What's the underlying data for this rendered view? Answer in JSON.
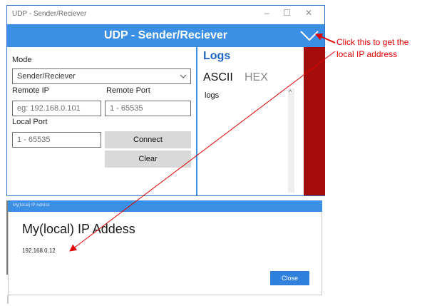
{
  "window": {
    "title_bar_text": "UDP - Sender/Reciever",
    "controls": {
      "minimize": "–",
      "maximize": "☐",
      "close": "✕"
    },
    "header_title": "UDP - Sender/Reciever",
    "colors": {
      "accent": "#3b8fe5",
      "red_panel": "#a50d0d"
    }
  },
  "left": {
    "mode_label": "Mode",
    "mode_value": "Sender/Reciever",
    "remote_ip_label": "Remote IP",
    "remote_ip_placeholder": "eg: 192.168.0.101",
    "remote_port_label": "Remote Port",
    "remote_port_placeholder": "1 - 65535",
    "local_port_label": "Local Port",
    "local_port_placeholder": "1 - 65535",
    "connect_label": "Connect",
    "clear_label": "Clear"
  },
  "right": {
    "logs_title": "Logs",
    "tab_ascii": "ASCII",
    "tab_hex": "HEX",
    "logs_text": "logs",
    "scroll_up_glyph": "^"
  },
  "dialog": {
    "title_bar_text": "My(local) IP Adress",
    "heading": "My(local) IP Addess",
    "ip_value": "192.168.0.12",
    "close_label": "Close"
  },
  "annotation": {
    "line1": "Click this to get the",
    "line2": "local IP address",
    "color": "#e00000"
  }
}
